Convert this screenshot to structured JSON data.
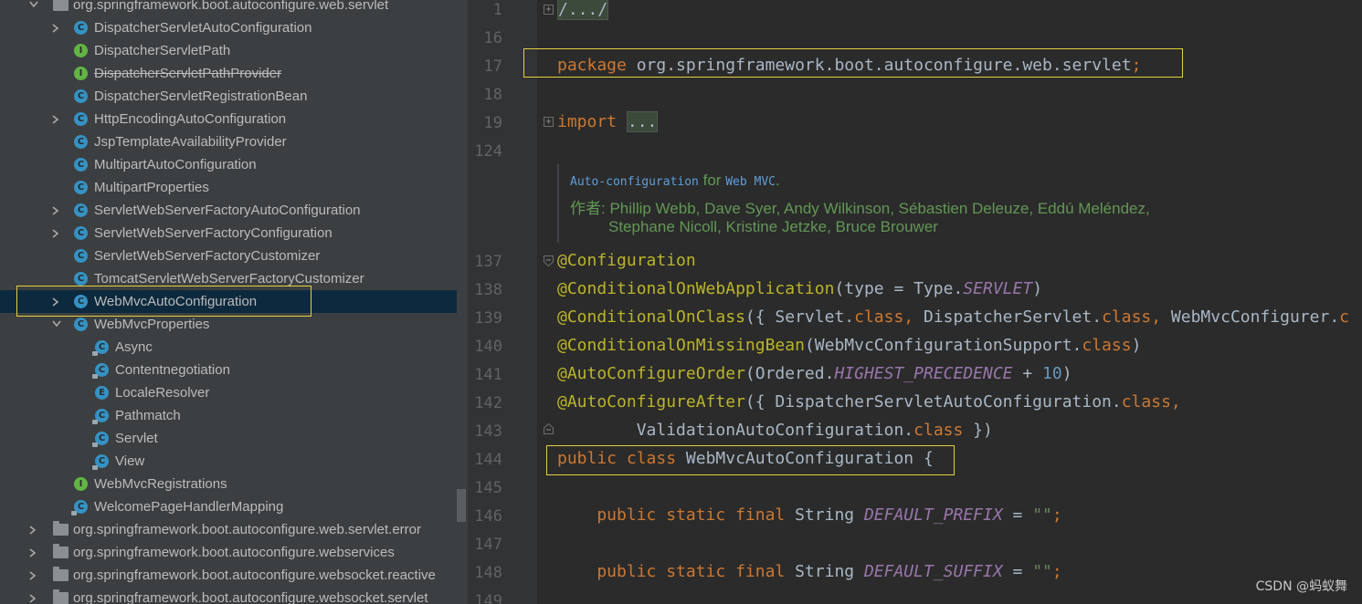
{
  "project_tree": {
    "items": [
      {
        "label": "org.springframework.boot.autoconfigure.web.servlet",
        "icon": "folder-icon",
        "arrow": "expanded"
      },
      {
        "label": "DispatcherServletAutoConfiguration",
        "icon": "class-icon",
        "arrow": "collapsed"
      },
      {
        "label": "DispatcherServletPath",
        "icon": "interface-icon"
      },
      {
        "label": "DispatcherServletPathProvider",
        "icon": "interface-icon",
        "strike": true
      },
      {
        "label": "DispatcherServletRegistrationBean",
        "icon": "class-icon"
      },
      {
        "label": "HttpEncodingAutoConfiguration",
        "icon": "class-icon",
        "arrow": "collapsed"
      },
      {
        "label": "JspTemplateAvailabilityProvider",
        "icon": "class-icon"
      },
      {
        "label": "MultipartAutoConfiguration",
        "icon": "class-icon"
      },
      {
        "label": "MultipartProperties",
        "icon": "class-icon"
      },
      {
        "label": "ServletWebServerFactoryAutoConfiguration",
        "icon": "class-icon",
        "arrow": "collapsed"
      },
      {
        "label": "ServletWebServerFactoryConfiguration",
        "icon": "class-icon",
        "arrow": "collapsed"
      },
      {
        "label": "ServletWebServerFactoryCustomizer",
        "icon": "class-icon"
      },
      {
        "label": "TomcatServletWebServerFactoryCustomizer",
        "icon": "class-icon"
      },
      {
        "label": "WebMvcAutoConfiguration",
        "icon": "class-icon",
        "arrow": "collapsed",
        "selected": true
      },
      {
        "label": "WebMvcProperties",
        "icon": "class-icon",
        "arrow": "expanded"
      },
      {
        "label": "Async",
        "icon": "class-icon"
      },
      {
        "label": "Contentnegotiation",
        "icon": "class-icon"
      },
      {
        "label": "LocaleResolver",
        "icon": "enum-icon"
      },
      {
        "label": "Pathmatch",
        "icon": "class-icon"
      },
      {
        "label": "Servlet",
        "icon": "class-icon"
      },
      {
        "label": "View",
        "icon": "class-icon"
      },
      {
        "label": "WebMvcRegistrations",
        "icon": "interface-icon"
      },
      {
        "label": "WelcomePageHandlerMapping",
        "icon": "class-icon"
      },
      {
        "label": "org.springframework.boot.autoconfigure.web.servlet.error",
        "icon": "folder-icon",
        "arrow": "collapsed"
      },
      {
        "label": "org.springframework.boot.autoconfigure.webservices",
        "icon": "folder-icon",
        "arrow": "collapsed"
      },
      {
        "label": "org.springframework.boot.autoconfigure.websocket.reactive",
        "icon": "folder-icon",
        "arrow": "collapsed"
      },
      {
        "label": "org.springframework.boot.autoconfigure.websocket.servlet",
        "icon": "folder-icon",
        "arrow": "collapsed"
      }
    ]
  },
  "editor": {
    "line_numbers": [
      "1",
      "16",
      "17",
      "18",
      "19",
      "124",
      "137",
      "138",
      "139",
      "140",
      "141",
      "142",
      "143",
      "144",
      "145",
      "146",
      "147",
      "148",
      "149"
    ],
    "line1_text": "/.../",
    "package_keyword": "package",
    "package_name": "org.springframework.boot.autoconfigure.web.servlet",
    "package_semicolon": ";",
    "import_keyword": "import",
    "import_folded": "...",
    "doc": {
      "summary_code1": "Auto-configuration",
      "summary_for": "for",
      "summary_code2": "Web MVC",
      "summary_dot": ".",
      "author_label": "作者:",
      "author_line1": "Phillip Webb, Dave Syer, Andy Wilkinson, Sébastien Deleuze, Eddú Meléndez,",
      "author_line2": "Stephane Nicoll, Kristine Jetzke, Bruce Brouwer"
    },
    "l137": {
      "ann": "@Configuration"
    },
    "l138": {
      "ann": "@ConditionalOnWebApplication",
      "p1": "(type = Type.",
      "s1": "SERVLET",
      "p2": ")"
    },
    "l139": {
      "ann": "@ConditionalOnClass",
      "p1": "({ Servlet.",
      "k1": "class, ",
      "p2": "DispatcherServlet.",
      "k2": "class, ",
      "p3": "WebMvcConfigurer.",
      "k3": "c"
    },
    "l140": {
      "ann": "@ConditionalOnMissingBean",
      "p1": "(WebMvcConfigurationSupport.",
      "k1": "class",
      "p2": ")"
    },
    "l141": {
      "ann": "@AutoConfigureOrder",
      "p1": "(Ordered.",
      "s1": "HIGHEST_PRECEDENCE",
      "p2": " + ",
      "n1": "10",
      "p3": ")"
    },
    "l142": {
      "ann": "@AutoConfigureAfter",
      "p1": "({ DispatcherServletAutoConfiguration.",
      "k1": "class,"
    },
    "l143": {
      "p1": "        ValidationAutoConfiguration.",
      "k1": "class",
      "p2": " })"
    },
    "l144": {
      "k1": "public class ",
      "p1": "WebMvcAutoConfiguration {"
    },
    "l146": {
      "k1": "    public static final ",
      "p1": "String ",
      "s1": "DEFAULT_PREFIX",
      "p2": " = ",
      "sv": "\"\"",
      "k2": ";"
    },
    "l148": {
      "k1": "    public static final ",
      "p1": "String ",
      "s1": "DEFAULT_SUFFIX",
      "p2": " = ",
      "sv": "\"\"",
      "k2": ";"
    }
  },
  "watermark": "CSDN @蚂蚁舞"
}
